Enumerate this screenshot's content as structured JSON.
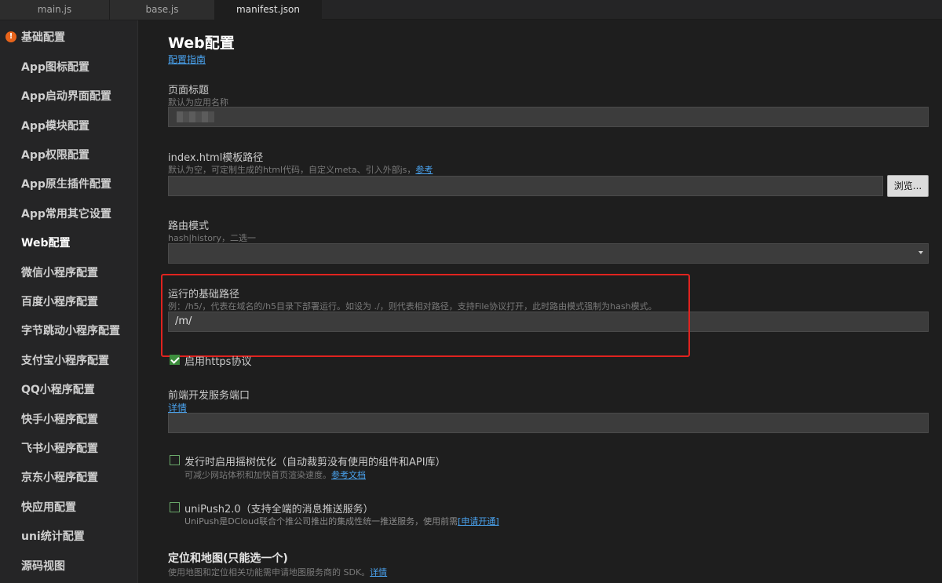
{
  "tabs": [
    {
      "label": "main.js"
    },
    {
      "label": "base.js"
    },
    {
      "label": "manifest.json"
    }
  ],
  "sidebar": {
    "items": [
      {
        "label": "基础配置"
      },
      {
        "label": "App图标配置"
      },
      {
        "label": "App启动界面配置"
      },
      {
        "label": "App模块配置"
      },
      {
        "label": "App权限配置"
      },
      {
        "label": "App原生插件配置"
      },
      {
        "label": "App常用其它设置"
      },
      {
        "label": "Web配置"
      },
      {
        "label": "微信小程序配置"
      },
      {
        "label": "百度小程序配置"
      },
      {
        "label": "字节跳动小程序配置"
      },
      {
        "label": "支付宝小程序配置"
      },
      {
        "label": "QQ小程序配置"
      },
      {
        "label": "快手小程序配置"
      },
      {
        "label": "飞书小程序配置"
      },
      {
        "label": "京东小程序配置"
      },
      {
        "label": "快应用配置"
      },
      {
        "label": "uni统计配置"
      },
      {
        "label": "源码视图"
      }
    ],
    "warn_icon": "!"
  },
  "main": {
    "title": "Web配置",
    "guide_link": "配置指南",
    "page_title": {
      "label": "页面标题",
      "hint": "默认为应用名称",
      "value": ""
    },
    "template": {
      "label": "index.html模板路径",
      "hint": "默认为空，可定制生成的html代码，自定义meta、引入外部js，",
      "hint_link": "参考",
      "value": "",
      "browse": "浏览..."
    },
    "router": {
      "label": "路由模式",
      "hint": "hash|history，二选一",
      "value": ""
    },
    "base_path": {
      "label": "运行的基础路径",
      "hint": "例：/h5/，代表在域名的/h5目录下部署运行。如设为 ./，则代表相对路径，支持File协议打开，此时路由模式强制为hash模式。",
      "value": "/m/"
    },
    "https": {
      "label": "启用https协议",
      "checked": true
    },
    "port": {
      "label": "前端开发服务端口",
      "link": "详情",
      "value": ""
    },
    "treeshake": {
      "label": "发行时启用摇树优化（自动裁剪没有使用的组件和API库）",
      "hint": "可减少网站体积和加快首页渲染速度。",
      "hint_link": "参考文档",
      "checked": false
    },
    "unipush": {
      "label": "uniPush2.0（支持全端的消息推送服务）",
      "hint": "UniPush是DCloud联合个推公司推出的集成性统一推送服务，使用前需",
      "hint_link": "[申请开通]",
      "checked": false
    },
    "maps": {
      "title": "定位和地图(只能选一个)",
      "hint": "使用地图和定位相关功能需申请地图服务商的 SDK。",
      "hint_link": "详情"
    }
  },
  "colors": {
    "accent_link": "#4aa3ef",
    "highlight_box": "#e0231f",
    "warn": "#e8641b",
    "checkbox": "#3d8d3d"
  }
}
